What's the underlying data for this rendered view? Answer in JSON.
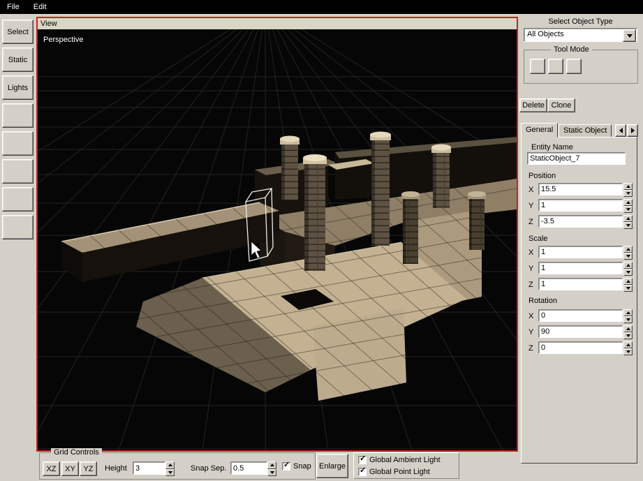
{
  "menu": {
    "file": "File",
    "edit": "Edit"
  },
  "left_toolbar": {
    "select": "Select",
    "static": "Static",
    "lights": "Lights"
  },
  "viewport": {
    "title": "View",
    "mode": "Perspective"
  },
  "right_panel": {
    "object_type_label": "Select Object Type",
    "object_type_value": "All Objects",
    "tool_mode_label": "Tool Mode",
    "delete_label": "Delete",
    "clone_label": "Clone",
    "tabs": {
      "general": "General",
      "static_object": "Static Object"
    },
    "entity_name_label": "Entity Name",
    "entity_name_value": "StaticObject_7",
    "axis": {
      "x": "X",
      "y": "Y",
      "z": "Z"
    },
    "position": {
      "label": "Position",
      "x": "15.5",
      "y": "1",
      "z": "-3.5"
    },
    "scale": {
      "label": "Scale",
      "x": "1",
      "y": "1",
      "z": "1"
    },
    "rotation": {
      "label": "Rotation",
      "x": "0",
      "y": "90",
      "z": "0"
    }
  },
  "bottom_bar": {
    "grid_controls_label": "Grid Controls",
    "plane_xz": "XZ",
    "plane_xy": "XY",
    "plane_yz": "YZ",
    "height_label": "Height",
    "height_value": "3",
    "snap_sep_label": "Snap Sep.",
    "snap_sep_value": "0.5",
    "snap_label": "Snap",
    "snap_checked": true,
    "enlarge_label": "Enlarge",
    "ambient_label": "Global Ambient Light",
    "ambient_checked": true,
    "point_label": "Global Point Light",
    "point_checked": true
  },
  "colors": {
    "viewport_border": "#c4251b",
    "chrome": "#d4d0c8",
    "scene_floor_tan": "#c3b192"
  }
}
